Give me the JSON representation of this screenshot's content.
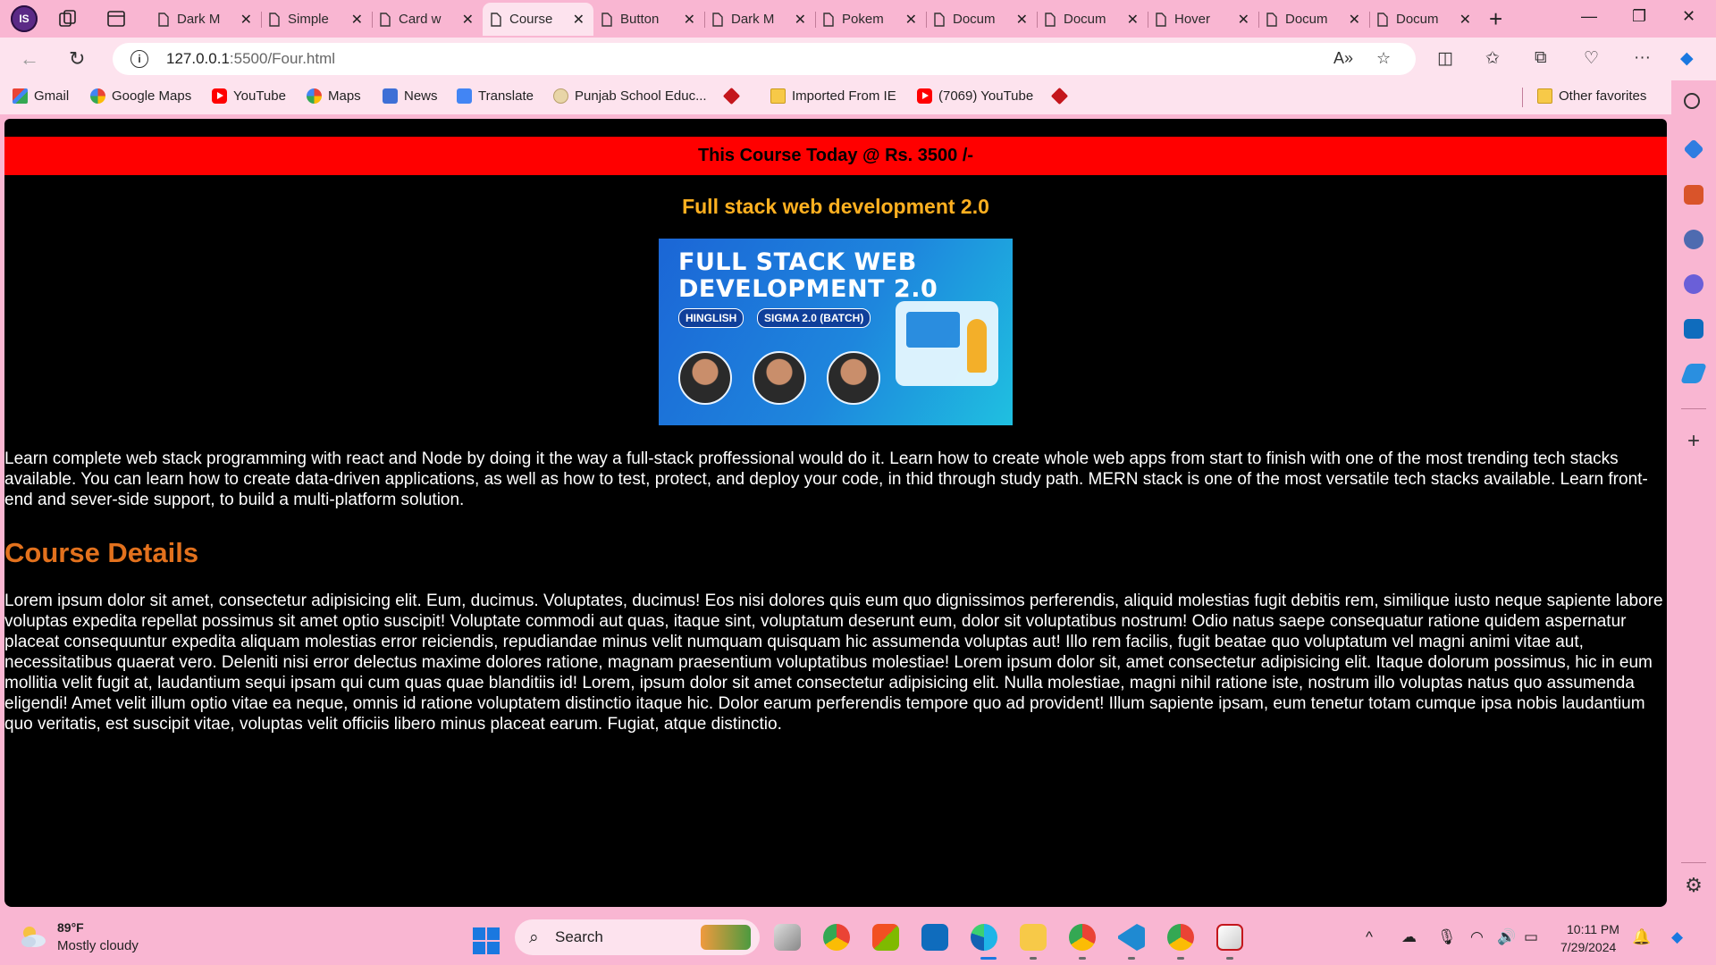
{
  "browser": {
    "profile_initials": "IS",
    "tabs": [
      {
        "label": "Dark M",
        "active": false
      },
      {
        "label": "Simple",
        "active": false
      },
      {
        "label": "Card w",
        "active": false
      },
      {
        "label": "Course",
        "active": true
      },
      {
        "label": "Button",
        "active": false
      },
      {
        "label": "Dark M",
        "active": false
      },
      {
        "label": "Pokem",
        "active": false
      },
      {
        "label": "Docum",
        "active": false
      },
      {
        "label": "Docum",
        "active": false
      },
      {
        "label": "Hover",
        "active": false
      },
      {
        "label": "Docum",
        "active": false
      },
      {
        "label": "Docum",
        "active": false
      }
    ],
    "address": {
      "host": "127.0.0.1",
      "rest": ":5500/Four.html"
    },
    "favorites": [
      {
        "label": "Gmail",
        "icon": "gmail-icon"
      },
      {
        "label": "Google Maps",
        "icon": "google-icon"
      },
      {
        "label": "YouTube",
        "icon": "youtube-icon"
      },
      {
        "label": "Maps",
        "icon": "google-icon"
      },
      {
        "label": "News",
        "icon": "news-icon"
      },
      {
        "label": "Translate",
        "icon": "translate-icon"
      },
      {
        "label": "Punjab School Educ...",
        "icon": "school-icon"
      },
      {
        "label": "",
        "icon": "diamond-icon"
      },
      {
        "label": "Imported From IE",
        "icon": "folder-icon"
      },
      {
        "label": "(7069) YouTube",
        "icon": "youtube-icon"
      },
      {
        "label": "",
        "icon": "diamond-icon"
      }
    ],
    "other_favorites": "Other favorites"
  },
  "page": {
    "promo": "This Course Today @ Rs. 3500 /-",
    "title": "Full stack web development 2.0",
    "banner": {
      "headline_1": "FULL STACK WEB",
      "headline_2": "DEVELOPMENT 2.0",
      "tag_1": "HINGLISH",
      "tag_2": "SIGMA 2.0 (BATCH)"
    },
    "intro": "Learn complete web stack programming with react and Node by doing it the way a full-stack proffessional would do it. Learn how to create whole web apps from start to finish with one of the most trending tech stacks available. You can learn how to create data-driven applications, as well as how to test, protect, and deploy your code, in thid through study path. MERN stack is one of the most versatile tech stacks available. Learn front-end and sever-side support, to build a multi-platform solution.",
    "section_heading": "Course Details",
    "details": "Lorem ipsum dolor sit amet, consectetur adipisicing elit. Eum, ducimus. Voluptates, ducimus! Eos nisi dolores quis eum quo dignissimos perferendis, aliquid molestias fugit debitis rem, similique iusto neque sapiente labore voluptas expedita repellat possimus sit amet optio suscipit! Voluptate commodi aut quas, itaque sint, voluptatum deserunt eum, dolor sit voluptatibus nostrum! Odio natus saepe consequatur ratione quidem aspernatur placeat consequuntur expedita aliquam molestias error reiciendis, repudiandae minus velit numquam quisquam hic assumenda voluptas aut! Illo rem facilis, fugit beatae quo voluptatum vel magni animi vitae aut, necessitatibus quaerat vero. Deleniti nisi error delectus maxime dolores ratione, magnam praesentium voluptatibus molestiae! Lorem ipsum dolor sit, amet consectetur adipisicing elit. Itaque dolorum possimus, hic in eum mollitia velit fugit at, laudantium sequi ipsam qui cum quas quae blanditiis id! Lorem, ipsum dolor sit amet consectetur adipisicing elit. Nulla molestiae, magni nihil ratione iste, nostrum illo voluptas natus quo assumenda eligendi! Amet velit illum optio vitae ea neque, omnis id ratione voluptatem distinctio itaque hic. Dolor earum perferendis tempore quo ad provident! Illum sapiente ipsam, eum tenetur totam cumque ipsa nobis laudantium quo veritatis, est suscipit vitae, voluptas velit officiis libero minus placeat earum. Fugiat, atque distinctio."
  },
  "taskbar": {
    "weather_temp": "89°F",
    "weather_condition": "Mostly cloudy",
    "search_label": "Search",
    "time": "10:11 PM",
    "date": "7/29/2024"
  },
  "colors": {
    "browser_chrome": "#f9b6d2",
    "page_background": "#000000",
    "promo_bar": "#ff0000",
    "title_color": "#ffb020",
    "heading_color": "#e2711d"
  }
}
